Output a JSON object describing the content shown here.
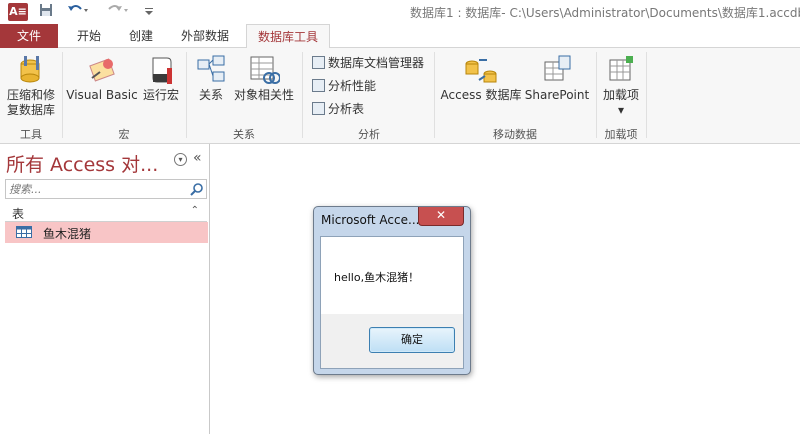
{
  "titlebar": {
    "app_icon": "A≡",
    "save_icon": "save-icon",
    "undo_icon": "undo-icon",
    "redo_icon": "redo-icon",
    "customize_icon": "customize-icon",
    "title": "数据库1 : 数据库- C:\\Users\\Administrator\\Documents\\数据库1.accdb"
  },
  "tabs": [
    {
      "label": "文件"
    },
    {
      "label": "开始"
    },
    {
      "label": "创建"
    },
    {
      "label": "外部数据"
    },
    {
      "label": "数据库工具"
    }
  ],
  "ribbon": {
    "groups": [
      {
        "label": "工具",
        "buttons": [
          {
            "label": "压缩和修",
            "label2": "复数据库",
            "icon": "compact-repair-icon"
          }
        ]
      },
      {
        "label": "宏",
        "buttons": [
          {
            "label": "Visual Basic",
            "icon": "visual-basic-icon"
          },
          {
            "label": "运行宏",
            "icon": "run-macro-icon"
          }
        ]
      },
      {
        "label": "关系",
        "buttons": [
          {
            "label": "关系",
            "icon": "relationships-icon"
          },
          {
            "label": "对象相关性",
            "icon": "object-dependencies-icon"
          }
        ]
      },
      {
        "label": "分析",
        "buttons": [
          {
            "label": "数据库文档管理器",
            "icon": "documenter-icon"
          },
          {
            "label": "分析性能",
            "icon": "analyze-performance-icon"
          },
          {
            "label": "分析表",
            "icon": "analyze-table-icon"
          }
        ]
      },
      {
        "label": "移动数据",
        "buttons": [
          {
            "label": "Access 数据库",
            "icon": "access-database-icon"
          },
          {
            "label": "SharePoint",
            "icon": "sharepoint-icon"
          }
        ]
      },
      {
        "label": "加载项",
        "buttons": [
          {
            "label": "加载项",
            "icon": "add-ins-icon"
          }
        ]
      }
    ]
  },
  "nav": {
    "title": "所有 Access 对...",
    "search_placeholder": "搜索...",
    "section": "表",
    "items": [
      {
        "label": "鱼木混猪",
        "icon": "table-icon"
      }
    ]
  },
  "dialog": {
    "title": "Microsoft Acce...",
    "close_label": "✕",
    "message": "hello,鱼木混猪！",
    "ok_label": "确定"
  },
  "colors": {
    "accent": "#a4373a",
    "nav_selected": "#f8c5c6",
    "dialog_frame": "#c5d6ea"
  }
}
